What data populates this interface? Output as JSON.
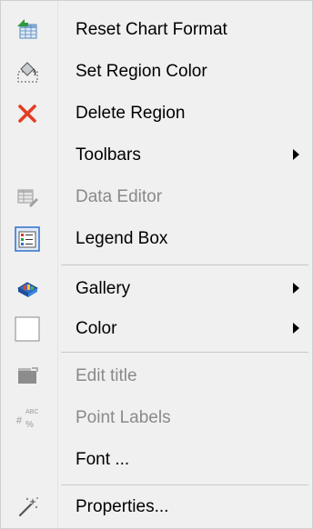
{
  "menu": {
    "items": [
      {
        "label": "Reset Chart Format",
        "icon": "reset-chart-format-icon",
        "disabled": false,
        "submenu": false
      },
      {
        "label": "Set Region Color",
        "icon": "paint-bucket-icon",
        "disabled": false,
        "submenu": false
      },
      {
        "label": "Delete Region",
        "icon": "red-x-delete-icon",
        "disabled": false,
        "submenu": false
      },
      {
        "label": "Toolbars",
        "icon": "",
        "disabled": false,
        "submenu": true
      },
      {
        "label": "Data Editor",
        "icon": "data-editor-icon",
        "disabled": true,
        "submenu": false
      },
      {
        "label": "Legend Box",
        "icon": "legend-box-icon",
        "disabled": false,
        "submenu": false
      },
      {
        "label": "Gallery",
        "icon": "gallery-icon",
        "disabled": false,
        "submenu": true
      },
      {
        "label": "Color",
        "icon": "color-swatch-icon",
        "disabled": false,
        "submenu": true
      },
      {
        "label": "Edit title",
        "icon": "edit-title-icon",
        "disabled": true,
        "submenu": false
      },
      {
        "label": "Point Labels",
        "icon": "point-labels-icon",
        "disabled": true,
        "submenu": false
      },
      {
        "label": "Font ...",
        "icon": "",
        "disabled": false,
        "submenu": false
      },
      {
        "label": "Properties...",
        "icon": "magic-wand-icon",
        "disabled": false,
        "submenu": false
      }
    ]
  },
  "colors": {
    "background": "#f0f0f0",
    "text": "#000000",
    "disabled_text": "#8a8a8a",
    "delete_red": "#e23d22",
    "legend_blue": "#2f6fc9"
  }
}
